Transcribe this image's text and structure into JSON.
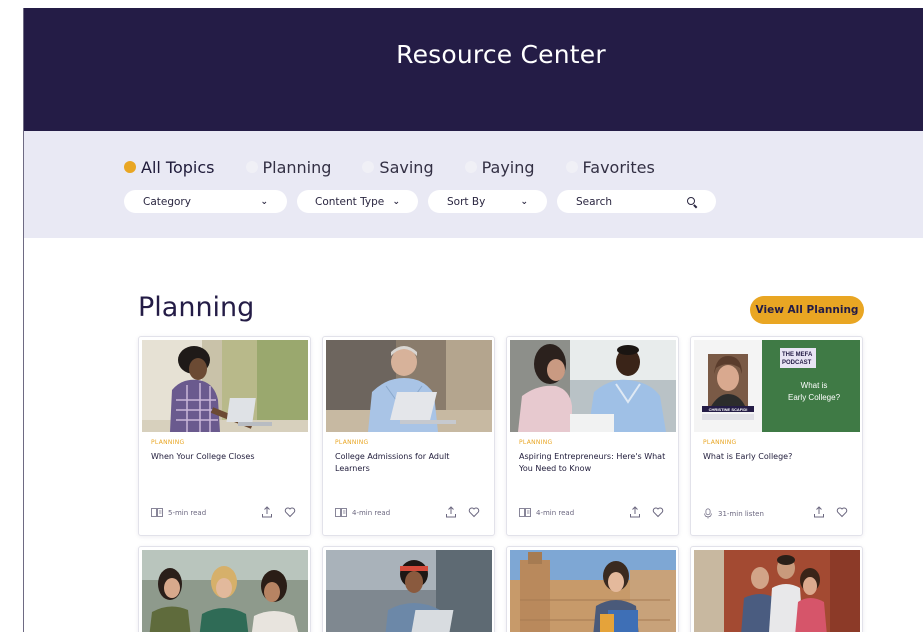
{
  "header": {
    "title": "Resource Center"
  },
  "tabs": [
    {
      "label": "All Topics",
      "active": true
    },
    {
      "label": "Planning",
      "active": false
    },
    {
      "label": "Saving",
      "active": false
    },
    {
      "label": "Paying",
      "active": false
    },
    {
      "label": "Favorites",
      "active": false
    }
  ],
  "filters": {
    "category": "Category",
    "content_type": "Content Type",
    "sort_by": "Sort By",
    "search_placeholder": "Search"
  },
  "section": {
    "title": "Planning",
    "view_all": "View All Planning"
  },
  "cards": [
    {
      "tag": "PLANNING",
      "title": "When Your College Closes",
      "meta": "5-min read",
      "meta_icon": "book-icon"
    },
    {
      "tag": "PLANNING",
      "title": "College Admissions for Adult Learners",
      "meta": "4-min read",
      "meta_icon": "book-icon"
    },
    {
      "tag": "PLANNING",
      "title": "Aspiring Entrepreneurs: Here's What You Need to Know",
      "meta": "4-min read",
      "meta_icon": "book-icon"
    },
    {
      "tag": "PLANNING",
      "title": "What is Early College?",
      "meta": "31-min listen",
      "meta_icon": "microphone-icon",
      "podcast": {
        "badge_line1": "THE MEFA",
        "badge_line2": "PODCAST",
        "caption_line1": "What is",
        "caption_line2": "Early College?",
        "guest": "CHRISTINE SCAFIDI"
      }
    }
  ],
  "colors": {
    "navy": "#241c46",
    "accent": "#e9a623",
    "filter_bg": "#e9e9f4",
    "podcast_green": "#3f7a45"
  }
}
